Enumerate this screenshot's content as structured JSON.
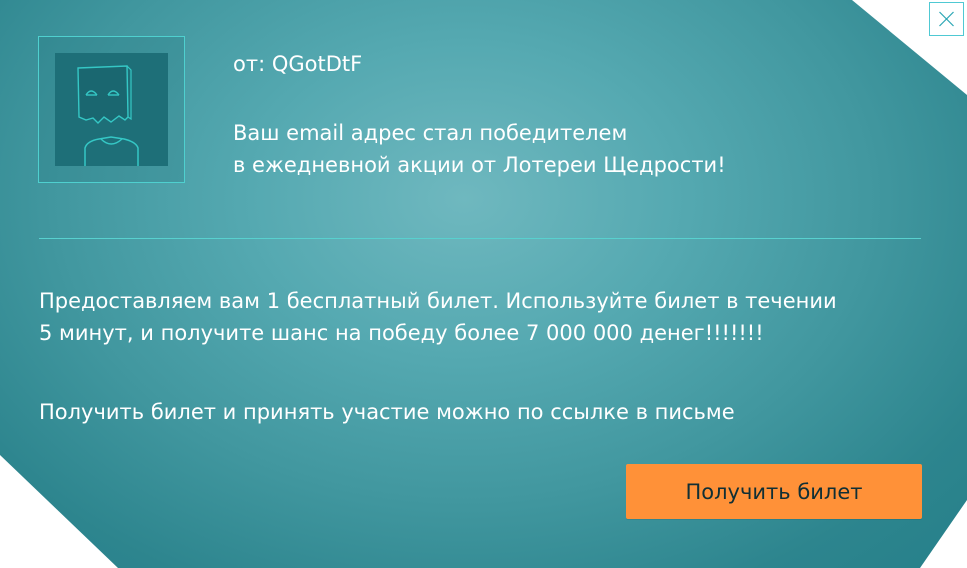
{
  "popup": {
    "from_label": "от: QGotDtF",
    "headline_line1": "Ваш email адрес стал победителем",
    "headline_line2": "в ежедневной акции от Лотереи Щедрости!",
    "body_line1": "Предоставляем вам 1 бесплатный билет. Используйте билет в течении",
    "body_line2": "5 минут, и получите шанс на победу более 7 000 000 денег!!!!!!!",
    "body_line3": "Получить билет и принять участие можно по ссылке в письме",
    "cta_label": "Получить билет",
    "icons": {
      "avatar": "paper-bag-head-avatar-icon",
      "close": "close-icon"
    },
    "colors": {
      "card_accent": "#4fd0cf",
      "cta_bg": "#ff9138",
      "cta_text": "#102f35",
      "text": "#ffffff"
    }
  }
}
